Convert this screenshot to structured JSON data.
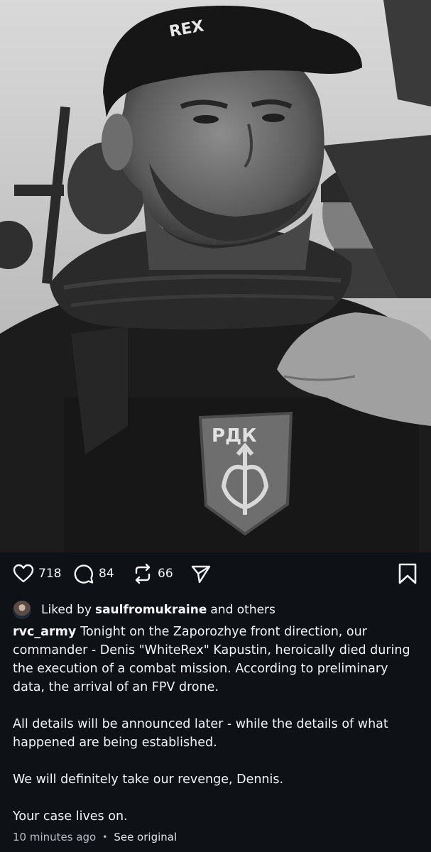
{
  "post": {
    "patch_text": "РДК",
    "cap_text": "REX",
    "likes": "718",
    "comments": "84",
    "reposts": "66",
    "liked_by": {
      "prefix": "Liked by",
      "user": "saulfromukraine",
      "suffix": "and others"
    },
    "caption": {
      "username": "rvc_army",
      "paragraphs": [
        "Tonight on the Zaporozhye front direction, our commander - Denis \"WhiteRex\" Kapustin, heroically died during the execution of a combat mission. According to preliminary data, the arrival of an FPV drone.",
        "All details will be announced later - while the details of what happened are being established.",
        "We will definitely take our revenge, Dennis.",
        "Your case lives on."
      ]
    },
    "timestamp": "10 minutes ago",
    "separator": "•",
    "see_original": "See original"
  },
  "icons": {
    "like": "heart-icon",
    "comment": "comment-bubble-icon",
    "repost": "repost-icon",
    "share": "share-paper-plane-icon",
    "save": "bookmark-icon"
  },
  "colors": {
    "background": "#0e1116",
    "text": "#f3f5f7",
    "muted": "#b9bec6"
  }
}
